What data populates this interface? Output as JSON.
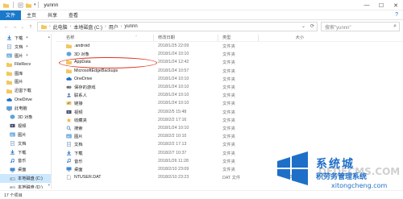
{
  "window": {
    "title": "yunnn",
    "minimize": "—",
    "maximize": "☐",
    "close": "✕"
  },
  "ribbon": {
    "file_tab": "文件",
    "tabs": [
      "主页",
      "共享",
      "查看"
    ],
    "help": "?"
  },
  "navigation": {
    "back": "←",
    "forward": "→",
    "recent": "⌄",
    "up": "↑"
  },
  "address": {
    "crumbs": [
      "此电脑",
      "本地磁盘 (C:)",
      "用户",
      "yunnn"
    ],
    "dropdown": "⌄",
    "refresh": "⟳"
  },
  "search": {
    "placeholder": "搜索\"yunnn\"",
    "icon": "search-icon"
  },
  "nav_pane": {
    "items": [
      {
        "label": "下载",
        "icon": "download-icon",
        "pinned": true
      },
      {
        "label": "文档",
        "icon": "document-icon",
        "pinned": true
      },
      {
        "label": "图片",
        "icon": "picture-icon",
        "pinned": true
      },
      {
        "label": "FileRecv",
        "icon": "folder-icon",
        "pinned": false
      },
      {
        "label": "图库",
        "icon": "folder-icon",
        "pinned": false
      },
      {
        "label": "图片",
        "icon": "folder-icon",
        "pinned": false
      },
      {
        "label": "迅雷下载",
        "icon": "folder-icon",
        "pinned": false
      },
      {
        "label": "OneDrive",
        "icon": "cloud-icon",
        "pinned": false
      },
      {
        "label": "此电脑",
        "icon": "computer-icon",
        "pinned": false
      },
      {
        "label": "3D 对象",
        "icon": "cube-icon",
        "pinned": false
      },
      {
        "label": "视频",
        "icon": "video-icon",
        "pinned": false
      },
      {
        "label": "图片",
        "icon": "picture-icon",
        "pinned": false
      },
      {
        "label": "文档",
        "icon": "document-icon",
        "pinned": false
      },
      {
        "label": "下载",
        "icon": "download-icon",
        "pinned": false
      },
      {
        "label": "音乐",
        "icon": "music-icon",
        "pinned": false
      },
      {
        "label": "桌面",
        "icon": "desktop-icon",
        "pinned": false
      },
      {
        "label": "本地磁盘 (C:)",
        "icon": "drive-icon",
        "pinned": false,
        "selected": true
      },
      {
        "label": "本地磁盘 (D:)",
        "icon": "drive-icon",
        "pinned": false
      }
    ]
  },
  "file_list": {
    "columns": {
      "name": "名称",
      "date": "修改日期",
      "type": "类型",
      "size": "大小"
    },
    "rows": [
      {
        "name": ".android",
        "date": "2018/1/25 22:09",
        "type": "文件夹",
        "size": "",
        "icon": "folder-icon"
      },
      {
        "name": "3D 对象",
        "date": "2018/1/24 10:10",
        "type": "文件夹",
        "size": "",
        "icon": "cube-icon"
      },
      {
        "name": "AppData",
        "date": "2018/1/24 12:42",
        "type": "文件夹",
        "size": "",
        "icon": "folder-icon"
      },
      {
        "name": "MicrosoftEdgeBackups",
        "date": "2018/1/24 10:57",
        "type": "文件夹",
        "size": "",
        "icon": "folder-icon"
      },
      {
        "name": "OneDrive",
        "date": "2018/1/24 10:10",
        "type": "文件夹",
        "size": "",
        "icon": "cloud-icon"
      },
      {
        "name": "保存的游戏",
        "date": "2018/1/24 10:10",
        "type": "文件夹",
        "size": "",
        "icon": "game-icon"
      },
      {
        "name": "联系人",
        "date": "2018/1/24 10:10",
        "type": "文件夹",
        "size": "",
        "icon": "contacts-icon"
      },
      {
        "name": "链接",
        "date": "2018/1/24 10:10",
        "type": "文件夹",
        "size": "",
        "icon": "link-icon"
      },
      {
        "name": "视频",
        "date": "2018/2/5 15:48",
        "type": "文件夹",
        "size": "",
        "icon": "video-icon"
      },
      {
        "name": "收藏夹",
        "date": "2018/2/2 17:16",
        "type": "文件夹",
        "size": "",
        "icon": "star-icon"
      },
      {
        "name": "搜索",
        "date": "2018/1/24 10:10",
        "type": "文件夹",
        "size": "",
        "icon": "search-icon"
      },
      {
        "name": "图片",
        "date": "2018/2/2 10:10",
        "type": "文件夹",
        "size": "",
        "icon": "picture-icon"
      },
      {
        "name": "文档",
        "date": "2018/2/2 17:13",
        "type": "文件夹",
        "size": "",
        "icon": "document-icon"
      },
      {
        "name": "下载",
        "date": "2018/2/7 10:37",
        "type": "文件夹",
        "size": "",
        "icon": "download-icon"
      },
      {
        "name": "音乐",
        "date": "2018/1/26 11:28",
        "type": "文件夹",
        "size": "",
        "icon": "music-icon"
      },
      {
        "name": "桌面",
        "date": "2018/2/10 23:09",
        "type": "文件夹",
        "size": "",
        "icon": "desktop-icon"
      },
      {
        "name": "NTUSER.DAT",
        "date": "2018/2/10 23:23",
        "type": "DAT 文件",
        "size": "2,304 KB",
        "icon": "file-icon"
      }
    ]
  },
  "status": {
    "item_count": "17 个项目"
  },
  "watermark": {
    "title": "系统城",
    "subtitle": "积劳务管理系统",
    "faded": "DEDECMS.COM",
    "site": "xitongcheng.com"
  },
  "colors": {
    "accent": "#1979ca",
    "folder": "#f2c75c",
    "highlight_ellipse": "#e0341e",
    "selected_bg": "#cce8ff"
  }
}
